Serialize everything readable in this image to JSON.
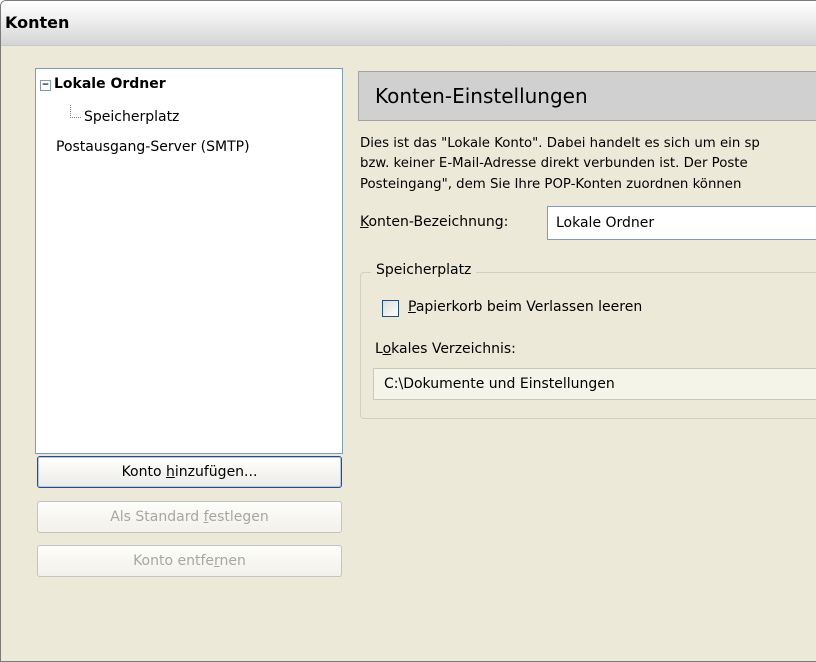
{
  "window": {
    "title": "Konten"
  },
  "tree": {
    "root": "Lokale Ordner",
    "root_toggle": "−",
    "child": "Speicherplatz",
    "smtp": "Postausgang-Server (SMTP)"
  },
  "buttons": {
    "add": {
      "before": "Konto ",
      "accel": "h",
      "after": "inzufügen..."
    },
    "standard": {
      "before": "Als Standard ",
      "accel": "f",
      "after": "estlegen"
    },
    "remove": {
      "before": "Konto entfe",
      "accel": "r",
      "after": "nen"
    }
  },
  "panel": {
    "header": "Konten-Einstellungen",
    "description": [
      "Dies ist das \"Lokale Konto\". Dabei handelt es sich um ein sp",
      "bzw. keiner E-Mail-Adresse direkt verbunden ist. Der Poste",
      "Posteingang\", dem Sie Ihre POP-Konten zuordnen können"
    ],
    "name_label": {
      "accel": "K",
      "after": "onten-Bezeichnung:"
    },
    "name_value": "Lokale Ordner",
    "storage": {
      "title": "Speicherplatz",
      "checkbox_label": {
        "accel": "P",
        "after": "apierkorb beim Verlassen leeren"
      },
      "checkbox_checked": false,
      "dir_label": {
        "before": "L",
        "accel": "o",
        "after": "kales Verzeichnis:"
      },
      "dir_value": "C:\\Dokumente und Einstellungen"
    }
  }
}
